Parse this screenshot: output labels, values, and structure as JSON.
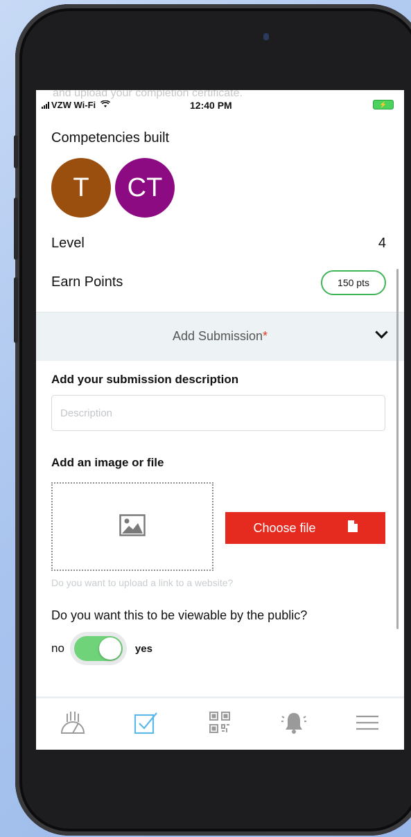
{
  "status_bar": {
    "ghost_text": "and upload your completion certificate.",
    "carrier": "VZW Wi-Fi",
    "time": "12:40 PM"
  },
  "competencies": {
    "title": "Competencies built",
    "badges": [
      {
        "initials": "T",
        "color": "#9b4f0f"
      },
      {
        "initials": "CT",
        "color": "#8c0b82"
      }
    ]
  },
  "level": {
    "label": "Level",
    "value": "4"
  },
  "earn_points": {
    "label": "Earn Points",
    "value": "150 pts"
  },
  "accordion": {
    "label": "Add Submission",
    "required_mark": "*"
  },
  "description": {
    "label": "Add your submission description",
    "placeholder": "Description",
    "value": ""
  },
  "file": {
    "label": "Add an image or file",
    "button_label": "Choose file"
  },
  "link_prompt": "Do you want to upload a link to a website?",
  "visibility": {
    "question": "Do you want this to be viewable by the public?",
    "off_label": "no",
    "on_label": "yes",
    "state": true
  },
  "tab_bar": {
    "tabs": [
      {
        "icon": "dashboard-gauge-icon",
        "active": false
      },
      {
        "icon": "checkbox-icon",
        "active": true
      },
      {
        "icon": "qr-code-icon",
        "active": false
      },
      {
        "icon": "bell-icon",
        "active": false
      },
      {
        "icon": "menu-icon",
        "active": false
      }
    ],
    "active_color": "#5bb8e8",
    "inactive_color": "#9a9a9a"
  },
  "colors": {
    "accent_red": "#e52b20",
    "toggle_green": "#6fd379",
    "pill_green": "#3fb456"
  }
}
